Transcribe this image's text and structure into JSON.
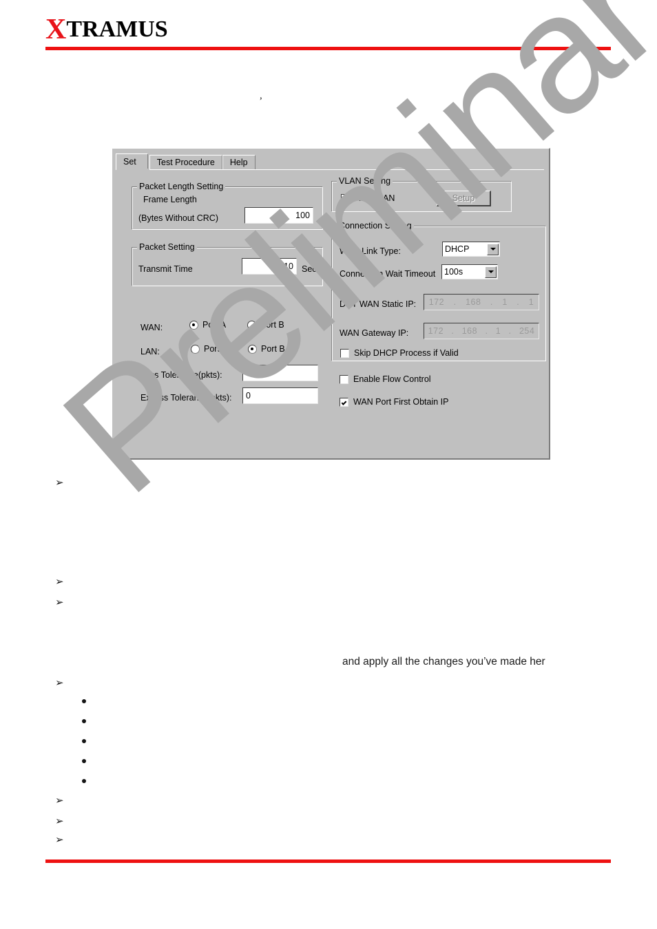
{
  "header": {
    "brand_x": "X",
    "brand_rest": "TRAMUS",
    "stray_mark": ","
  },
  "watermark": {
    "text": "Preliminary"
  },
  "dialog": {
    "tabs": [
      {
        "label": "Set",
        "active": true
      },
      {
        "label": "Test Procedure",
        "active": false
      },
      {
        "label": "Help",
        "active": false
      }
    ],
    "packet_length_setting": {
      "title": "Packet Length Setting",
      "frame_length_label": "Frame Length",
      "bytes_label": "(Bytes Without CRC)",
      "frame_length_value": "100"
    },
    "packet_setting": {
      "title": "Packet Setting",
      "transmit_time_label": "Transmit Time",
      "transmit_time_value": "10",
      "transmit_time_unit": "Sec."
    },
    "port_selection": {
      "wan_label": "WAN:",
      "lan_label": "LAN:",
      "wan_port_a": "Port A",
      "wan_port_b": "Port B",
      "lan_port_a": "Port A",
      "lan_port_b": "Port B"
    },
    "tolerance": {
      "loss_label": "Loss Tolerance(pkts):",
      "loss_value": "0",
      "excess_label": "Excess Tolerance(pkts):",
      "excess_value": "0"
    },
    "vlan_setting": {
      "title": "VLAN Setting",
      "add_vlan_label": "Add VLAN",
      "setup_button": "Setup"
    },
    "connection_setting": {
      "title": "Connection Setting",
      "wan_link_type_label": "WAN Link Type:",
      "wan_link_type_value": "DHCP",
      "wait_timeout_label": "Connection Wait Timeout",
      "wait_timeout_value": "100s",
      "dut_wan_static_ip_label": "DUT WAN Static IP:",
      "dut_wan_static_ip": [
        "172",
        "168",
        "1",
        "1"
      ],
      "wan_gateway_ip_label": "WAN Gateway IP:",
      "wan_gateway_ip": [
        "172",
        "168",
        "1",
        "254"
      ],
      "skip_dhcp_label": "Skip DHCP Process if Valid"
    },
    "options": {
      "enable_flow_control_label": "Enable Flow Control",
      "wan_port_first_obtain_ip_label": "WAN Port First Obtain IP"
    }
  },
  "body": {
    "arrow_glyph": "➢",
    "trailing_text": "and apply all the changes you’ve made her"
  },
  "colors": {
    "brand_red": "#e8131a",
    "rule_red": "#ee1111",
    "dialog_face": "#c0c0c0",
    "watermark_gray": "#a8a8a8",
    "disabled_text": "#8a8a8a"
  }
}
